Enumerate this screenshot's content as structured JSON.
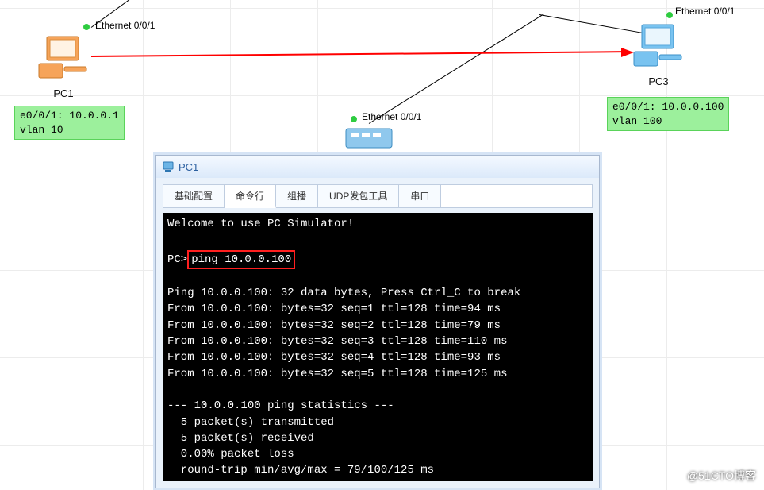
{
  "topology": {
    "pc1": {
      "label": "PC1",
      "port_dot": true,
      "port_label": "Ethernet 0/0/1",
      "info": "e0/0/1: 10.0.0.1\nvlan 10"
    },
    "pc3": {
      "label": "PC3",
      "port_dot": true,
      "port_label": "Ethernet 0/0/1",
      "info": "e0/0/1: 10.0.0.100\nvlan 100"
    },
    "switch": {
      "port_label": "Ethernet 0/0/1"
    }
  },
  "window": {
    "title": "PC1",
    "tabs": [
      {
        "label": "基础配置"
      },
      {
        "label": "命令行"
      },
      {
        "label": "组播"
      },
      {
        "label": "UDP发包工具"
      },
      {
        "label": "串口"
      }
    ],
    "terminal": {
      "welcome": "Welcome to use PC Simulator!",
      "prompt": "PC>",
      "command": "ping 10.0.0.100",
      "output": [
        "",
        "Ping 10.0.0.100: 32 data bytes, Press Ctrl_C to break",
        "From 10.0.0.100: bytes=32 seq=1 ttl=128 time=94 ms",
        "From 10.0.0.100: bytes=32 seq=2 ttl=128 time=79 ms",
        "From 10.0.0.100: bytes=32 seq=3 ttl=128 time=110 ms",
        "From 10.0.0.100: bytes=32 seq=4 ttl=128 time=93 ms",
        "From 10.0.0.100: bytes=32 seq=5 ttl=128 time=125 ms",
        "",
        "--- 10.0.0.100 ping statistics ---",
        "  5 packet(s) transmitted",
        "  5 packet(s) received",
        "  0.00% packet loss",
        "  round-trip min/avg/max = 79/100/125 ms"
      ]
    }
  },
  "watermark": "@51CTO博客"
}
